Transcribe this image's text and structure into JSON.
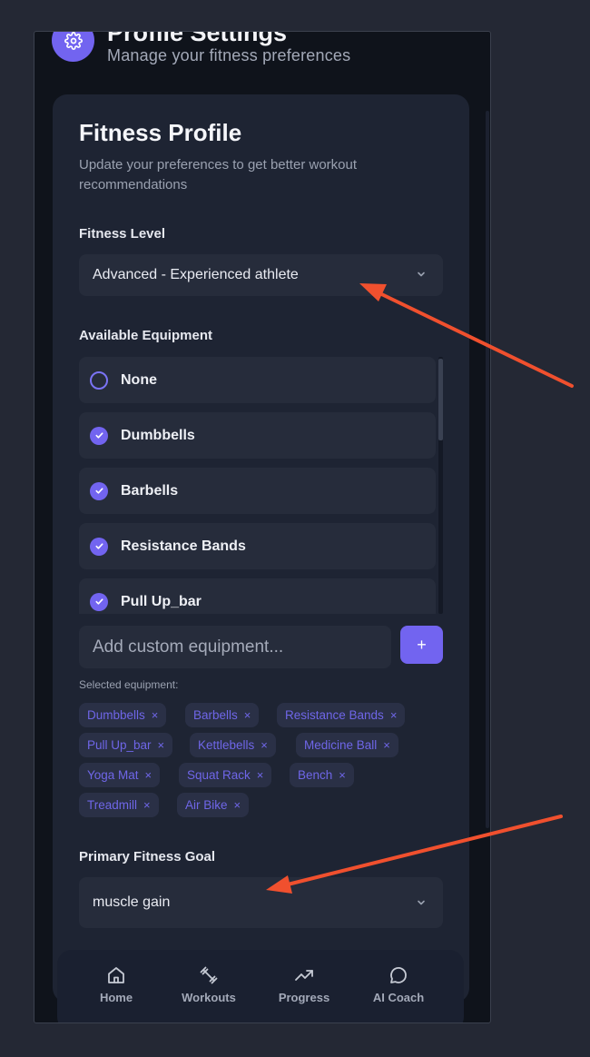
{
  "header": {
    "title": "Profile Settings",
    "subtitle": "Manage your fitness preferences",
    "icon": "gear-icon"
  },
  "card": {
    "title": "Fitness Profile",
    "description": "Update your preferences to get better workout recommendations"
  },
  "fitness_level": {
    "label": "Fitness Level",
    "value": "Advanced - Experienced athlete"
  },
  "equipment": {
    "label": "Available Equipment",
    "items": [
      {
        "name": "None",
        "checked": false
      },
      {
        "name": "Dumbbells",
        "checked": true
      },
      {
        "name": "Barbells",
        "checked": true
      },
      {
        "name": "Resistance Bands",
        "checked": true
      },
      {
        "name": "Pull Up_bar",
        "checked": true
      }
    ],
    "custom_placeholder": "Add custom equipment...",
    "add_label": "+",
    "selected_label": "Selected equipment:",
    "selected": [
      "Dumbbells",
      "Barbells",
      "Resistance Bands",
      "Pull Up_bar",
      "Kettlebells",
      "Medicine Ball",
      "Yoga Mat",
      "Squat Rack",
      "Bench",
      "Treadmill",
      "Air Bike"
    ],
    "remove_glyph": "×"
  },
  "goal": {
    "label": "Primary Fitness Goal",
    "value": "muscle gain"
  },
  "nav": [
    {
      "label": "Home",
      "icon": "home-icon"
    },
    {
      "label": "Workouts",
      "icon": "dumbbell-icon"
    },
    {
      "label": "Progress",
      "icon": "trending-up-icon"
    },
    {
      "label": "AI Coach",
      "icon": "chat-bubble-icon"
    }
  ],
  "colors": {
    "accent": "#7264f0",
    "background": "#0f131b",
    "card": "#1e2433",
    "annotation_arrow": "#f0502e"
  }
}
